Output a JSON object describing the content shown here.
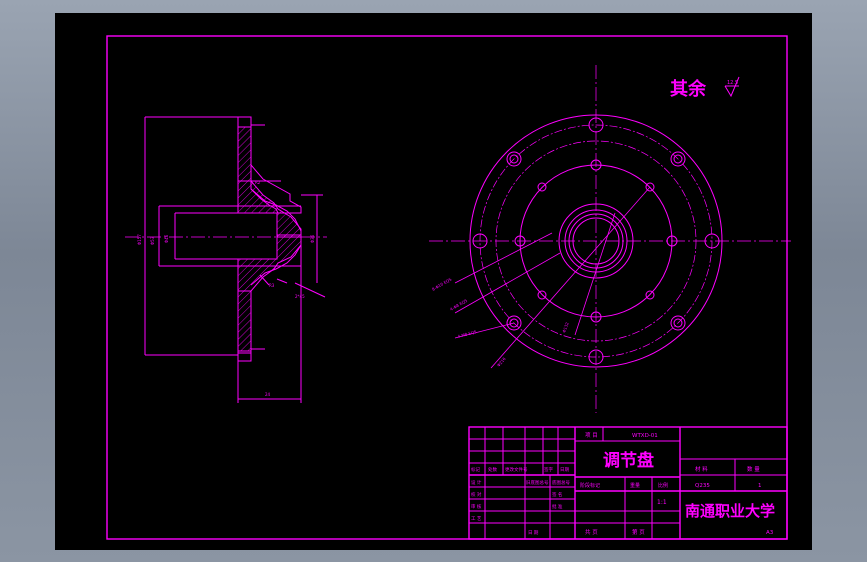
{
  "part_name": "调节盘",
  "drawing_no": "WTXD-01",
  "material": "Q235",
  "quantity": "1",
  "scale": "1:1",
  "school": "南通职业大学",
  "sheet_size": "A3",
  "surface_note": "其余",
  "roughness_value": "12.5",
  "title_block": {
    "project_label": "项  目",
    "material_label": "材  料",
    "quantity_label": "数  量",
    "weight_label": "重量",
    "scale_label": "比例",
    "stage_label": "阶段标记",
    "sheets_total": "共   页",
    "sheet_no": "第   页",
    "date_label": "日  期",
    "marks": [
      "标记",
      "处数",
      "更改文件号",
      "签字",
      "日期"
    ],
    "roles": [
      "设  计",
      "校  对",
      "审  核",
      "工  艺"
    ],
    "mid1": [
      "旧底图总号",
      "底图总号"
    ],
    "mid2": [
      "签  名"
    ],
    "mid3": [
      "批  准"
    ]
  },
  "colors": {
    "line": "#ff00ff",
    "background": "#000000",
    "accent_text": "#ffffff"
  }
}
